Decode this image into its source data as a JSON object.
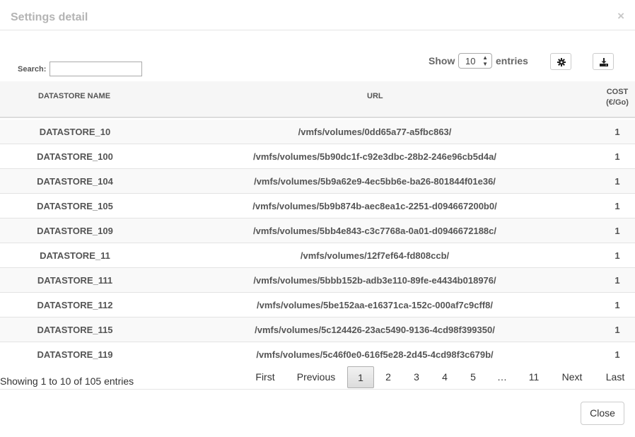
{
  "dialog": {
    "title": "Settings detail",
    "close_x": "×"
  },
  "controls": {
    "search_label": "Search:",
    "search_value": "",
    "show_label": "Show",
    "page_size": "10",
    "entries_label": "entries",
    "settings_icon": "gear-icon",
    "download_icon": "download-icon"
  },
  "table": {
    "headers": {
      "name": "DATASTORE NAME",
      "url": "URL",
      "cost_line1": "COST",
      "cost_line2": "(€/Go)"
    },
    "rows": [
      {
        "name": "DATASTORE_10",
        "url": "/vmfs/volumes/0dd65a77-a5fbc863/",
        "cost": "1"
      },
      {
        "name": "DATASTORE_100",
        "url": "/vmfs/volumes/5b90dc1f-c92e3dbc-28b2-246e96cb5d4a/",
        "cost": "1"
      },
      {
        "name": "DATASTORE_104",
        "url": "/vmfs/volumes/5b9a62e9-4ec5bb6e-ba26-801844f01e36/",
        "cost": "1"
      },
      {
        "name": "DATASTORE_105",
        "url": "/vmfs/volumes/5b9b874b-aec8ea1c-2251-d094667200b0/",
        "cost": "1"
      },
      {
        "name": "DATASTORE_109",
        "url": "/vmfs/volumes/5bb4e843-c3c7768a-0a01-d0946672188c/",
        "cost": "1"
      },
      {
        "name": "DATASTORE_11",
        "url": "/vmfs/volumes/12f7ef64-fd808ccb/",
        "cost": "1"
      },
      {
        "name": "DATASTORE_111",
        "url": "/vmfs/volumes/5bbb152b-adb3e110-89fe-e4434b018976/",
        "cost": "1"
      },
      {
        "name": "DATASTORE_112",
        "url": "/vmfs/volumes/5be152aa-e16371ca-152c-000af7c9cff8/",
        "cost": "1"
      },
      {
        "name": "DATASTORE_115",
        "url": "/vmfs/volumes/5c124426-23ac5490-9136-4cd98f399350/",
        "cost": "1"
      },
      {
        "name": "DATASTORE_119",
        "url": "/vmfs/volumes/5c46f0e0-616f5e28-2d45-4cd98f3c679b/",
        "cost": "1"
      }
    ]
  },
  "pagination": {
    "info": "Showing 1 to 10 of 105 entries",
    "first": "First",
    "previous": "Previous",
    "pages": [
      "1",
      "2",
      "3",
      "4",
      "5"
    ],
    "ellipsis": "…",
    "last_page": "11",
    "next": "Next",
    "last": "Last",
    "current_page": "1"
  },
  "footer": {
    "close_label": "Close"
  }
}
